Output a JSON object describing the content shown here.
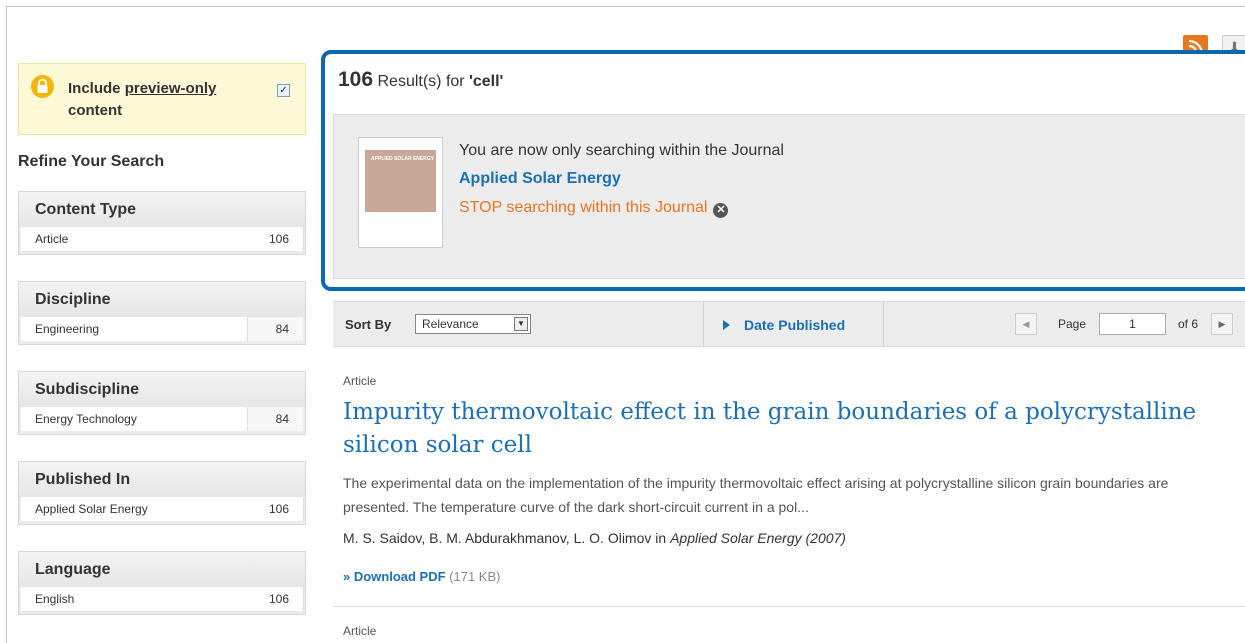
{
  "toolbar": {
    "rss_icon": "rss-icon",
    "download_icon": "download-icon"
  },
  "preview": {
    "label_part1": "Include ",
    "label_part2": "preview-only",
    "label_part3": "content",
    "checked_mark": "✓"
  },
  "refine_title": "Refine Your Search",
  "facets": [
    {
      "title": "Content Type",
      "item": "Article",
      "count": "106"
    },
    {
      "title": "Discipline",
      "item": "Engineering",
      "count": "84"
    },
    {
      "title": "Subdiscipline",
      "item": "Energy Technology",
      "count": "84"
    },
    {
      "title": "Published In",
      "item": "Applied Solar Energy",
      "count": "106"
    },
    {
      "title": "Language",
      "item": "English",
      "count": "106"
    }
  ],
  "results": {
    "count": "106",
    "label": " Result(s) for ",
    "query": "'cell'"
  },
  "journal": {
    "searching_within": "You are now only searching within the Journal",
    "name": "Applied Solar Energy",
    "stop": "STOP searching within this Journal",
    "cover_title": "APPLIED SOLAR ENERGY"
  },
  "sort": {
    "label": "Sort By",
    "selected": "Relevance",
    "date_published": "Date Published"
  },
  "pager": {
    "page_label": "Page",
    "current": "1",
    "of_label": "of 6"
  },
  "article": {
    "type": "Article",
    "title": "Impurity thermovoltaic effect in the grain boundaries of a polycrystalline silicon solar cell",
    "abstract": "The experimental data on the implementation of the impurity thermovoltaic effect arising at polycrystalline silicon grain boundaries are presented. The temperature curve of the dark short-circuit current in a pol...",
    "authors": "M. S. Saidov, B. M. Abdurakhmanov, L. O. Olimov",
    "in_label": " in ",
    "journal": "Applied Solar Energy (2007)",
    "download_label": "» Download PDF",
    "download_size": " (171 KB)"
  },
  "article2": {
    "type": "Article"
  }
}
